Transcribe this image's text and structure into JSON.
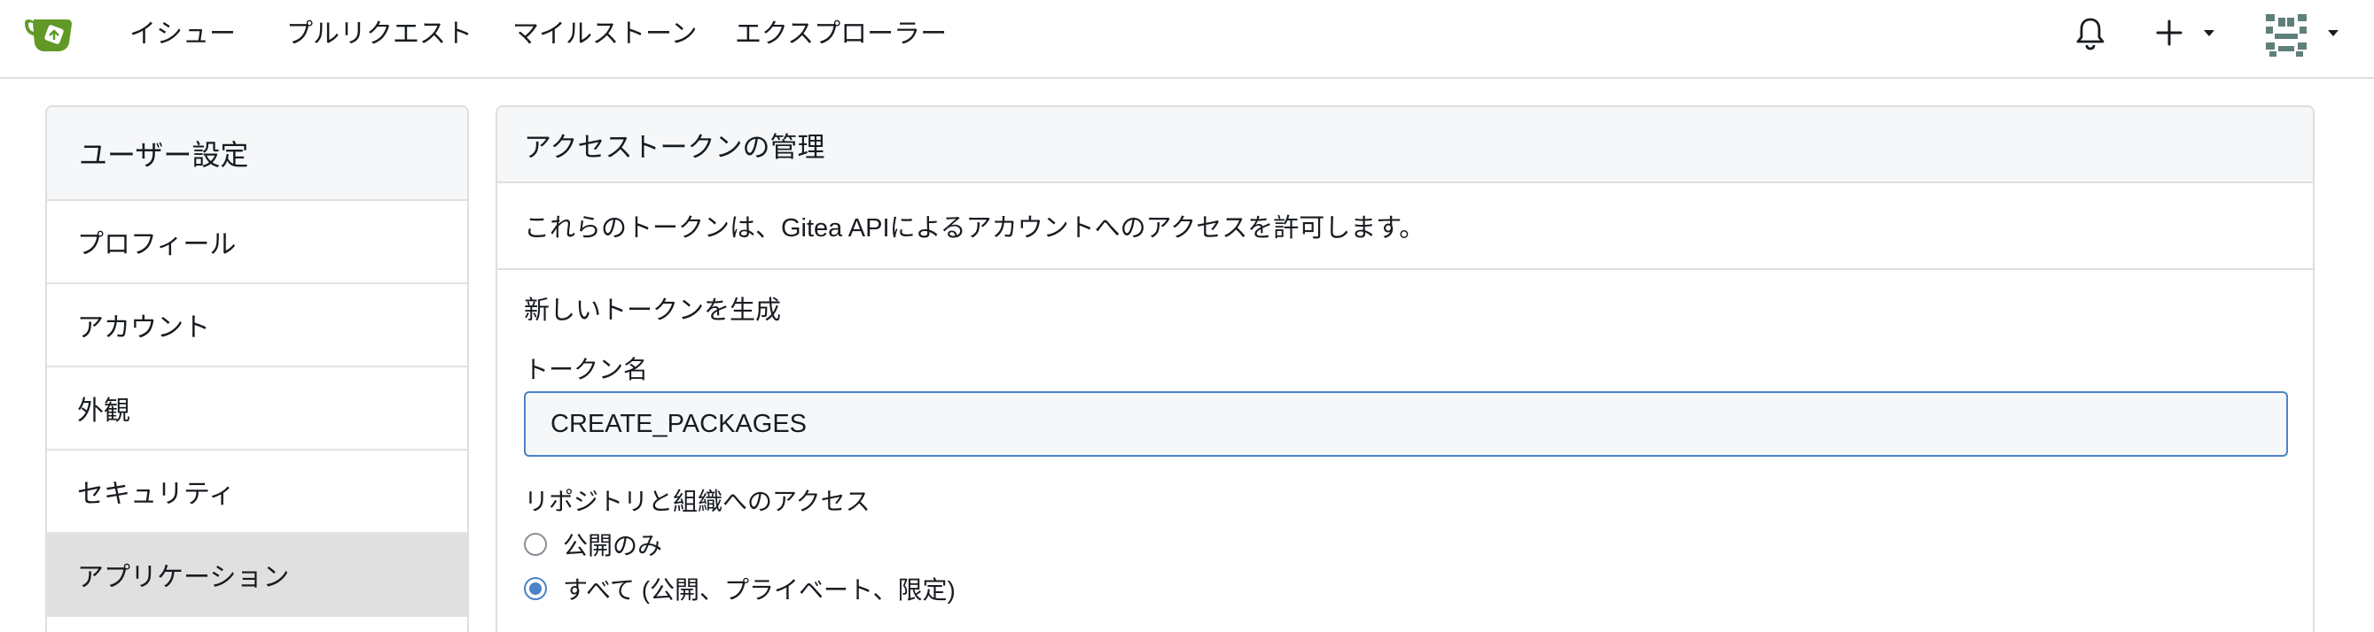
{
  "navbar": {
    "logo_icon": "gitea-teacup-logo-icon",
    "logo_color": "#609926",
    "items": [
      {
        "label": "イシュー"
      },
      {
        "label": "プルリクエスト"
      },
      {
        "label": "マイルストーン"
      },
      {
        "label": "エクスプローラー"
      }
    ],
    "notification_icon": "bell-icon",
    "create_icon": "plus-icon",
    "user_icon": "identicon-avatar"
  },
  "sidebar": {
    "header": "ユーザー設定",
    "items": [
      {
        "label": "プロフィール",
        "active": false
      },
      {
        "label": "アカウント",
        "active": false
      },
      {
        "label": "外観",
        "active": false
      },
      {
        "label": "セキュリティ",
        "active": false
      },
      {
        "label": "アプリケーション",
        "active": true
      }
    ]
  },
  "main": {
    "header": "アクセストークンの管理",
    "description": "これらのトークンは、Gitea APIによるアカウントへのアクセスを許可します。",
    "form": {
      "section_title": "新しいトークンを生成",
      "token_name_label": "トークン名",
      "token_name_value": "CREATE_PACKAGES",
      "access_label": "リポジトリと組織へのアクセス",
      "options": [
        {
          "label": "公開のみ",
          "selected": false
        },
        {
          "label": "すべて (公開、プライベート、限定)",
          "selected": true
        }
      ]
    }
  },
  "colors": {
    "accent": "#4b82c8",
    "active_sidebar_bg": "#e0e0e0",
    "header_bg": "#f6f7f8",
    "border": "#dedede"
  }
}
